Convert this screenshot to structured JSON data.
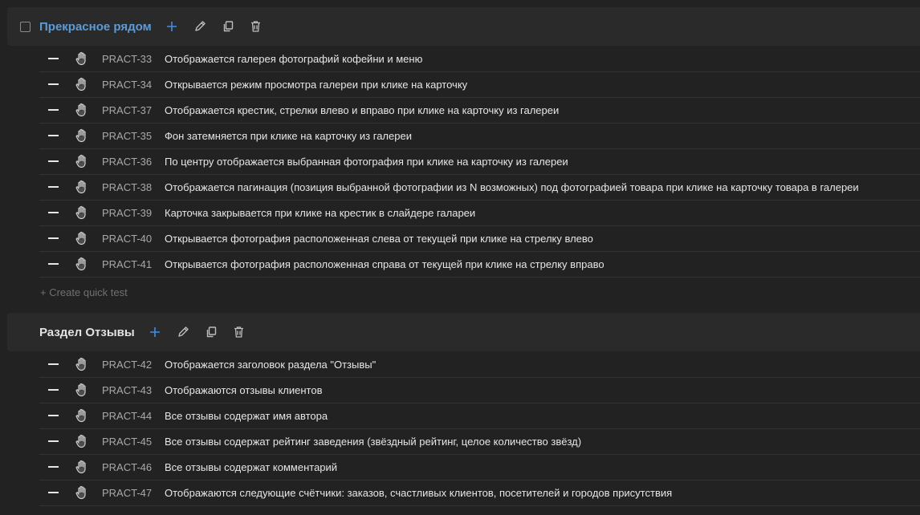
{
  "suites": [
    {
      "title": "Прекрасное рядом",
      "cases": [
        {
          "id": "PRACT-33",
          "title": "Отображается галерея фотографий кофейни и меню"
        },
        {
          "id": "PRACT-34",
          "title": "Открывается режим просмотра галереи при клике на карточку"
        },
        {
          "id": "PRACT-37",
          "title": "Отображается крестик, стрелки влево и вправо при клике на карточку из галереи"
        },
        {
          "id": "PRACT-35",
          "title": "Фон затемняется при клике на карточку из галереи"
        },
        {
          "id": "PRACT-36",
          "title": "По центру отображается выбранная фотография при клике на карточку из галереи"
        },
        {
          "id": "PRACT-38",
          "title": "Отображается пагинация (позиция выбранной фотографии из N возможных) под фотографией товара при клике на карточку товара в галереи"
        },
        {
          "id": "PRACT-39",
          "title": "Карточка закрывается при клике на крестик в слайдере галареи"
        },
        {
          "id": "PRACT-40",
          "title": "Открывается фотография расположенная слева от текущей при клике на стрелку влево"
        },
        {
          "id": "PRACT-41",
          "title": "Открывается фотография расположенная справа от текущей при клике на стрелку вправо"
        }
      ],
      "quick_create": "+ Create quick test"
    },
    {
      "title": "Раздел Отзывы",
      "cases": [
        {
          "id": "PRACT-42",
          "title": "Отображается заголовок раздела \"Отзывы\""
        },
        {
          "id": "PRACT-43",
          "title": "Отображаются отзывы клиентов"
        },
        {
          "id": "PRACT-44",
          "title": "Все отзывы содержат имя автора"
        },
        {
          "id": "PRACT-45",
          "title": "Все отзывы содержат рейтинг заведения (звёздный рейтинг, целое количество звёзд)"
        },
        {
          "id": "PRACT-46",
          "title": "Все отзывы содержат комментарий"
        },
        {
          "id": "PRACT-47",
          "title": "Отображаются следующие счётчики: заказов, счастливых клиентов, посетителей и городов присутствия"
        }
      ]
    }
  ],
  "icons": {
    "add": "plus-icon",
    "edit": "pencil-icon",
    "clone": "copy-icon",
    "delete": "trash-icon",
    "collapse": "minus-icon",
    "drag": "hand-icon"
  },
  "colors": {
    "background": "#222222",
    "suite_header": "#2a2a2a",
    "link_title": "#5b9bd8",
    "accent_add": "#3f8ee8"
  }
}
